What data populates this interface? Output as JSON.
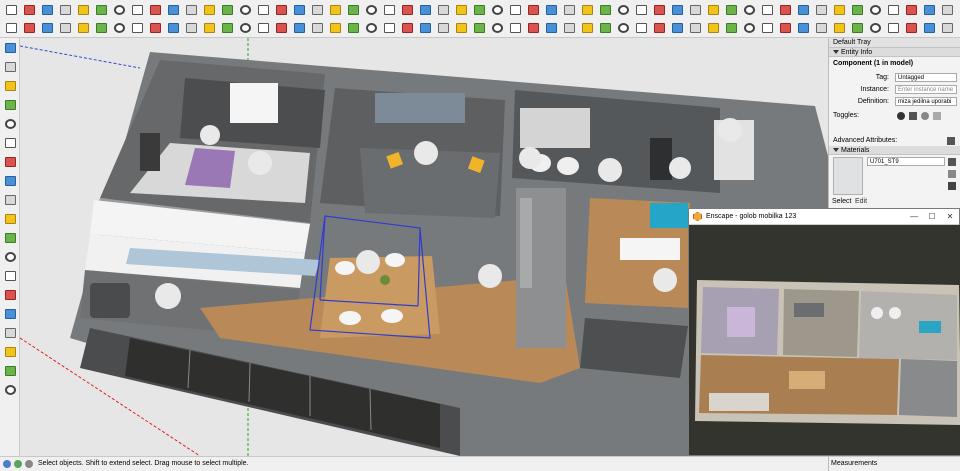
{
  "tray": {
    "title": "Default Tray",
    "entity_info": {
      "panel_title": "Entity Info",
      "summary": "Component (1 in model)",
      "tag_label": "Tag:",
      "tag_value": "Untagged",
      "instance_label": "Instance:",
      "instance_placeholder": "Enter instance name",
      "definition_label": "Definition:",
      "definition_value": "miza jedilna uporabi",
      "toggles_label": "Toggles:",
      "advanced_label": "Advanced Attributes:"
    },
    "materials": {
      "panel_title": "Materials",
      "material_name": "U701_ST9",
      "tabs": [
        "Select",
        "Edit"
      ]
    }
  },
  "enscape": {
    "title": "Enscape - golob mobilka 123"
  },
  "statusbar": {
    "message": "Select objects. Shift to extend select. Drag mouse to select multiple.",
    "measurements_label": "Measurements"
  },
  "colors": {
    "axis_red": "#e02020",
    "axis_green": "#2fa12f",
    "axis_blue": "#2f4bd6",
    "selection_blue": "#2f3ccf",
    "floor_wood": "#b98a57",
    "wall_gray": "#5d5f61"
  },
  "toolbar_icons": {
    "top_row1": [
      "arrow-select-icon",
      "component-icon",
      "paint-bucket-icon",
      "eraser-icon",
      "line-icon",
      "freehand-icon",
      "rectangle-icon",
      "rotated-rectangle-icon",
      "circle-icon",
      "polygon-icon",
      "arc-icon",
      "pie-icon",
      "push-pull-icon",
      "move-icon",
      "rotate-icon",
      "follow-me-icon",
      "scale-icon",
      "offset-icon",
      "tape-measure-icon",
      "dimension-icon",
      "protractor-icon",
      "text-icon",
      "axes-icon",
      "3d-text-icon",
      "orbit-icon",
      "pan-icon",
      "zoom-icon",
      "zoom-window-icon",
      "zoom-extents-icon",
      "previous-view-icon",
      "position-camera-icon",
      "walk-icon",
      "look-around-icon",
      "section-plane-icon",
      "display-section-icon",
      "sandbox-icon",
      "style-icon",
      "shadow-icon",
      "fog-icon",
      "model-info-icon",
      "warehouse-icon",
      "extension-icon",
      "layout-icon",
      "enscape-start-icon",
      "enscape-sync-icon",
      "enscape-view-icon",
      "enscape-capture-icon",
      "enscape-settings-icon",
      "enscape-asset-icon",
      "enscape-upload-icon",
      "enscape-feedback-icon",
      "solid-tools-icon",
      "outer-shell-icon",
      "intersect-icon",
      "union-icon",
      "subtract-icon",
      "trim-icon",
      "split-icon"
    ],
    "top_row2": [
      "select-icon",
      "group-icon",
      "component-make-icon",
      "iso-view-icon",
      "top-view-icon",
      "front-view-icon",
      "right-view-icon",
      "back-view-icon",
      "left-view-icon",
      "xray-icon",
      "back-edges-icon",
      "wireframe-icon",
      "hidden-line-icon",
      "shaded-icon",
      "textured-icon",
      "monochrome-icon",
      "profile-icon",
      "layer-icon",
      "outliner-icon",
      "scene-icon",
      "section-cut-icon",
      "section-fill-icon",
      "sandbox-smoove-icon",
      "sandbox-stamp-icon",
      "sandbox-drape-icon",
      "sandbox-grid-icon",
      "sandbox-flip-icon",
      "add-detail-icon",
      "photo-match-icon",
      "geo-location-icon",
      "terrain-icon",
      "import-icon",
      "export-icon",
      "print-icon",
      "cloud-icon",
      "share-icon",
      "trimble-connect-icon",
      "report-icon",
      "dynamic-component-icon",
      "interact-icon",
      "component-options-icon",
      "attribute-icon",
      "soften-edges-icon",
      "fix-normals-icon",
      "reverse-faces-icon",
      "orient-faces-icon",
      "stitch-icon",
      "curve-icon",
      "bezier-icon",
      "spline-icon",
      "arc-tool-icon",
      "offset-curve-icon",
      "extrude-icon",
      "loft-icon",
      "joint-push-pull-icon",
      "round-corner-icon"
    ],
    "left": [
      "arrow-icon",
      "component-icon",
      "paint-icon",
      "eraser-icon",
      "pencil-icon",
      "freehand-icon",
      "rectangle-icon",
      "rotated-rect-icon",
      "circle-icon",
      "polygon-icon",
      "arc-icon",
      "pie-icon",
      "push-pull-icon",
      "move-icon",
      "rotate-icon",
      "follow-me-icon",
      "scale-icon",
      "offset-icon",
      "tape-measure-icon",
      "dimension-icon",
      "protractor-icon",
      "text-icon",
      "axes-icon",
      "3d-text-icon",
      "orbit-icon",
      "pan-icon",
      "zoom-icon",
      "zoom-window-icon",
      "zoom-extents-icon",
      "position-camera-icon",
      "walk-icon",
      "look-around-icon",
      "section-plane-icon",
      "eye-icon",
      "footprints-icon",
      "sandbox-icon"
    ]
  }
}
